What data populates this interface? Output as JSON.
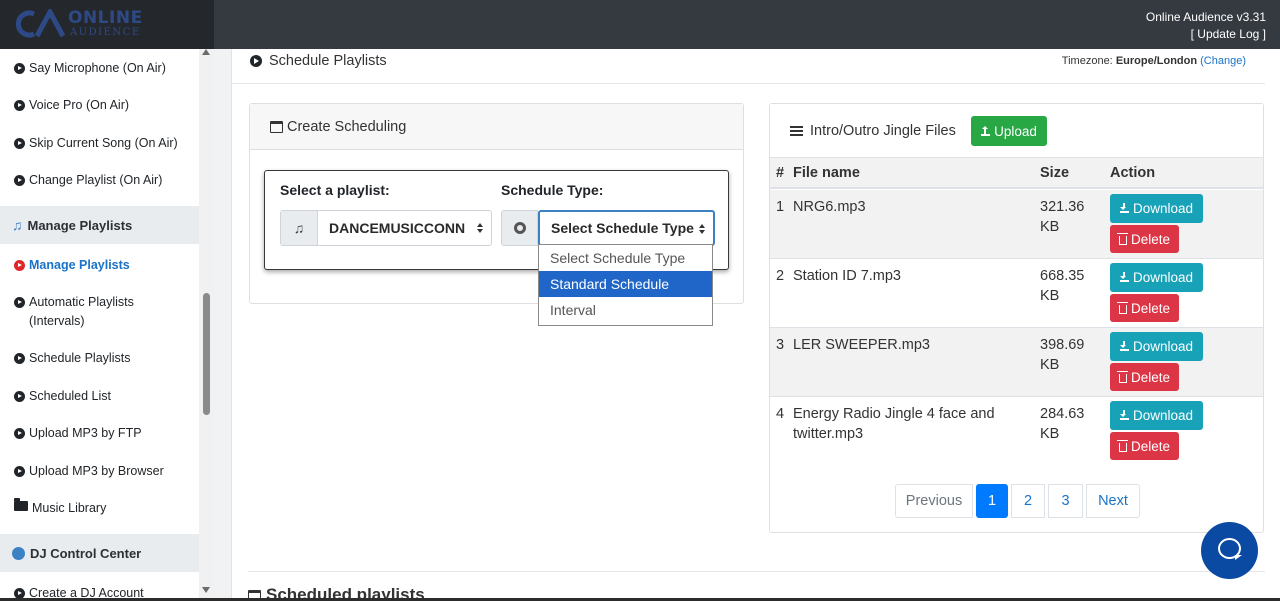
{
  "app": {
    "logo_line1": "ONLINE",
    "logo_line2": "AUDIENCE",
    "version": "Online Audience v3.31",
    "update_log": "[ Update Log ]"
  },
  "sidebar": {
    "items_top": [
      {
        "label": "Say Microphone (On Air)"
      },
      {
        "label": "Voice Pro (On Air)"
      },
      {
        "label": "Skip Current Song (On Air)"
      },
      {
        "label": "Change Playlist (On Air)"
      }
    ],
    "section_playlists": "Manage Playlists",
    "items_playlists": [
      {
        "label": "Manage Playlists"
      },
      {
        "label": "Automatic Playlists (Intervals)"
      },
      {
        "label": "Schedule Playlists"
      },
      {
        "label": "Scheduled List"
      },
      {
        "label": "Upload MP3 by FTP"
      },
      {
        "label": "Upload MP3 by Browser"
      },
      {
        "label": "Music Library"
      }
    ],
    "section_dj": "DJ Control Center",
    "items_dj": [
      {
        "label": "Create a DJ Account"
      }
    ]
  },
  "page": {
    "title": "Schedule Playlists",
    "timezone_label": "Timezone:",
    "timezone_value": "Europe/London",
    "timezone_change": "(Change)"
  },
  "create": {
    "title": "Create Scheduling",
    "playlist_label": "Select a playlist:",
    "playlist_value": "DANCEMUSICCONN",
    "type_label": "Schedule Type:",
    "type_value": "Select Schedule Type",
    "type_options": [
      "Select Schedule Type",
      "Standard Schedule",
      "Interval"
    ]
  },
  "jingles": {
    "title": "Intro/Outro Jingle Files",
    "upload_label": "Upload",
    "headers": {
      "num": "#",
      "file": "File name",
      "size": "Size",
      "action": "Action"
    },
    "rows": [
      {
        "num": "1",
        "file": "NRG6.mp3",
        "size": "321.36",
        "unit": "KB"
      },
      {
        "num": "2",
        "file": "Station ID 7.mp3",
        "size": "668.35",
        "unit": "KB"
      },
      {
        "num": "3",
        "file": "LER SWEEPER.mp3",
        "size": "398.69",
        "unit": "KB"
      },
      {
        "num": "4",
        "file": "Energy Radio Jingle 4 face and twitter.mp3",
        "size": "284.63",
        "unit": "KB"
      }
    ],
    "download_label": "Download",
    "delete_label": "Delete",
    "pagination": {
      "prev": "Previous",
      "pages": [
        "1",
        "2",
        "3"
      ],
      "next": "Next",
      "current": "1"
    }
  },
  "bottom": {
    "title": "Scheduled playlists"
  },
  "colors": {
    "accent": "#007bff",
    "upload": "#28a745",
    "download": "#17a2b8",
    "delete": "#dc3545",
    "active_nav": "#1a73c8"
  }
}
